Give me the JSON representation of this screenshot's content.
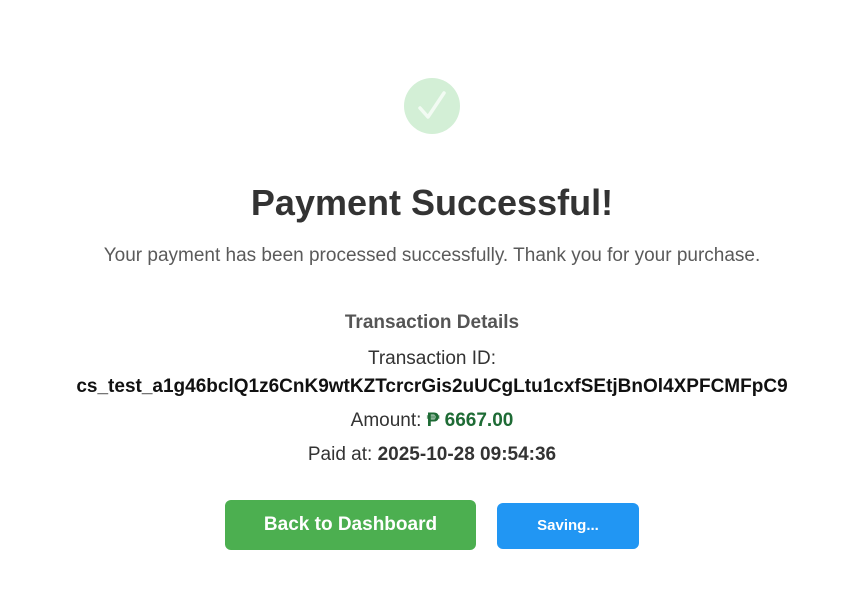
{
  "success_icon": "checkmark-icon",
  "title": "Payment Successful!",
  "subtitle": "Your payment has been processed successfully. Thank you for your purchase.",
  "details": {
    "heading": "Transaction Details",
    "transaction_id_label": "Transaction ID:",
    "transaction_id": "cs_test_a1g46bclQ1z6CnK9wtKZTcrcrGis2uUCgLtu1cxfSEtjBnOl4XPFCMFpC9",
    "amount_label": "Amount:",
    "amount_value": "₱ 6667.00",
    "paid_at_label": "Paid at:",
    "paid_at_value": "2025-10-28 09:54:36"
  },
  "buttons": {
    "dashboard_label": "Back to Dashboard",
    "saving_label": "Saving..."
  },
  "colors": {
    "success_green": "#4caf50",
    "saving_blue": "#2196f3",
    "amount_green": "#1e6b35",
    "icon_bg": "#d3efd6"
  }
}
